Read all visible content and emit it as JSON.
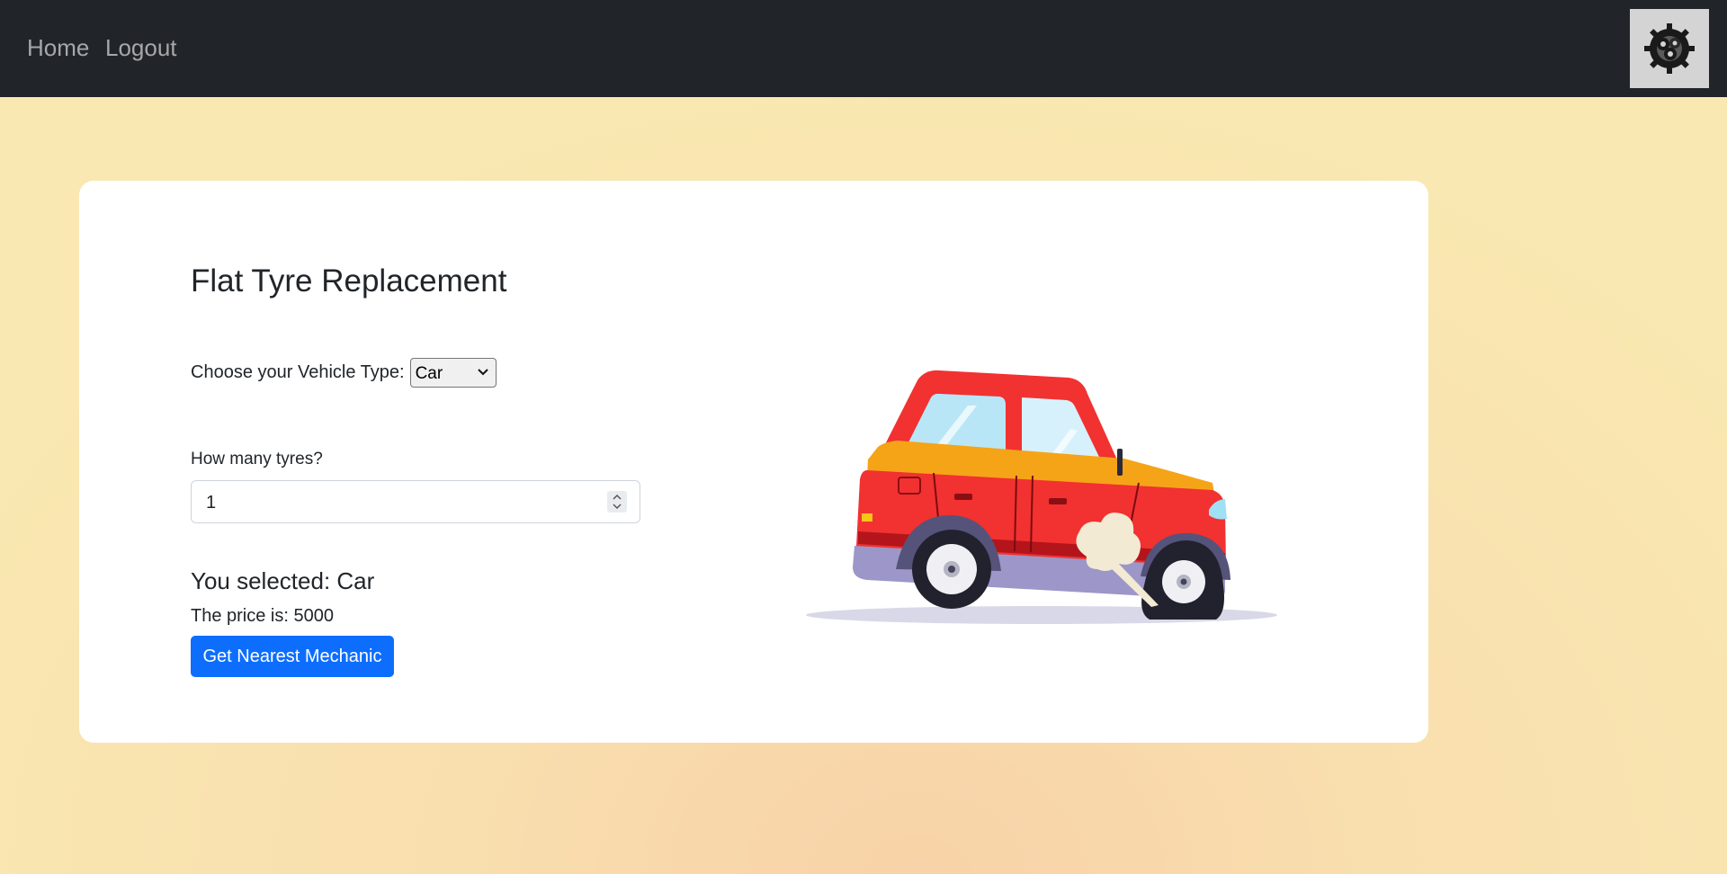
{
  "nav": {
    "home_label": "Home",
    "logout_label": "Logout",
    "logo_icon": "gears-icon"
  },
  "service": {
    "title": "Flat Tyre Replacement",
    "vehicle_label": "Choose your Vehicle Type:",
    "vehicle_selected": "Car",
    "tyres_label": "How many tyres?",
    "tyres_value": "1",
    "selected_text": "You selected: Car",
    "price_text": "The price is: 5000",
    "button_label": "Get Nearest Mechanic"
  },
  "illustration": {
    "icon": "flat-tyre-car-illustration"
  },
  "colors": {
    "navbar": "#212529",
    "primary_button": "#0d6efd",
    "card": "#ffffff"
  }
}
